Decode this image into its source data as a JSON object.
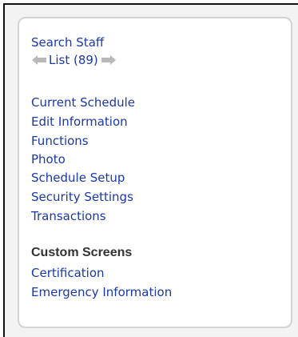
{
  "nav": {
    "search_staff": "Search Staff",
    "list_label": "List (89)"
  },
  "menu": {
    "items": [
      "Current Schedule",
      "Edit Information",
      "Functions",
      "Photo",
      "Schedule Setup",
      "Security Settings",
      "Transactions"
    ]
  },
  "custom": {
    "heading": "Custom Screens",
    "items": [
      "Certification",
      "Emergency Information"
    ]
  },
  "colors": {
    "link": "#1a39a8",
    "arrow": "#b9b9b9",
    "panel_border": "#d3d3d3",
    "heading": "#333333"
  },
  "icons": {
    "prev": "arrow-left-icon",
    "next": "arrow-right-icon"
  }
}
